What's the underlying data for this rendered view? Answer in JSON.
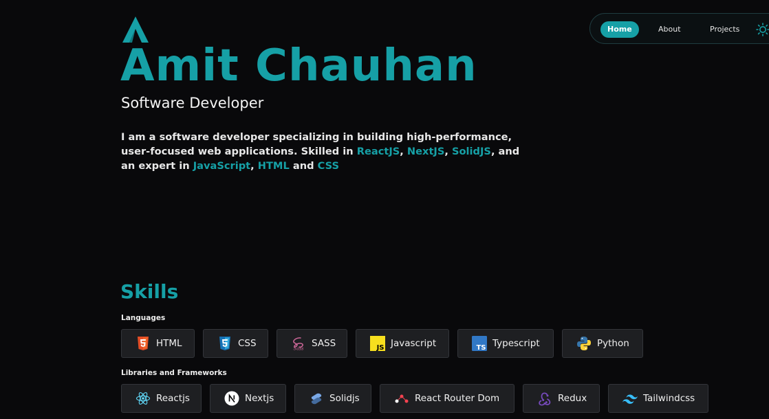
{
  "header": {
    "name": "Amit Chauhan",
    "role": "Software Developer"
  },
  "bio": {
    "part1": "I am a software developer specializing in building high-performance, user-focused web applications. Skilled in ",
    "react": "ReactJS",
    "sep1": ", ",
    "next": "NextJS",
    "sep2": ", ",
    "solid": "SolidJS",
    "part2": ", and an expert in ",
    "js": "JavaScript",
    "sep3": ", ",
    "html": "HTML",
    "part3": " and ",
    "css": "CSS"
  },
  "nav": {
    "items": [
      {
        "label": "Home",
        "active": true
      },
      {
        "label": "About"
      },
      {
        "label": "Projects"
      }
    ],
    "theme_icon": "sun-icon"
  },
  "skills": {
    "title": "Skills",
    "languages_label": "Languages",
    "languages": [
      {
        "label": "HTML",
        "icon": "html5-icon"
      },
      {
        "label": "CSS",
        "icon": "css3-icon"
      },
      {
        "label": "SASS",
        "icon": "sass-icon"
      },
      {
        "label": "Javascript",
        "icon": "javascript-icon"
      },
      {
        "label": "Typescript",
        "icon": "typescript-icon"
      },
      {
        "label": "Python",
        "icon": "python-icon"
      }
    ],
    "frameworks_label": "Libraries and Frameworks",
    "frameworks": [
      {
        "label": "Reactjs",
        "icon": "react-icon"
      },
      {
        "label": "Nextjs",
        "icon": "nextjs-icon"
      },
      {
        "label": "Solidjs",
        "icon": "solidjs-icon"
      },
      {
        "label": "React Router Dom",
        "icon": "react-router-icon"
      },
      {
        "label": "Redux",
        "icon": "redux-icon"
      },
      {
        "label": "Tailwindcss",
        "icon": "tailwind-icon"
      }
    ]
  },
  "colors": {
    "accent": "#16a0a6",
    "background": "#09090b",
    "chip": "#1e1f22"
  }
}
